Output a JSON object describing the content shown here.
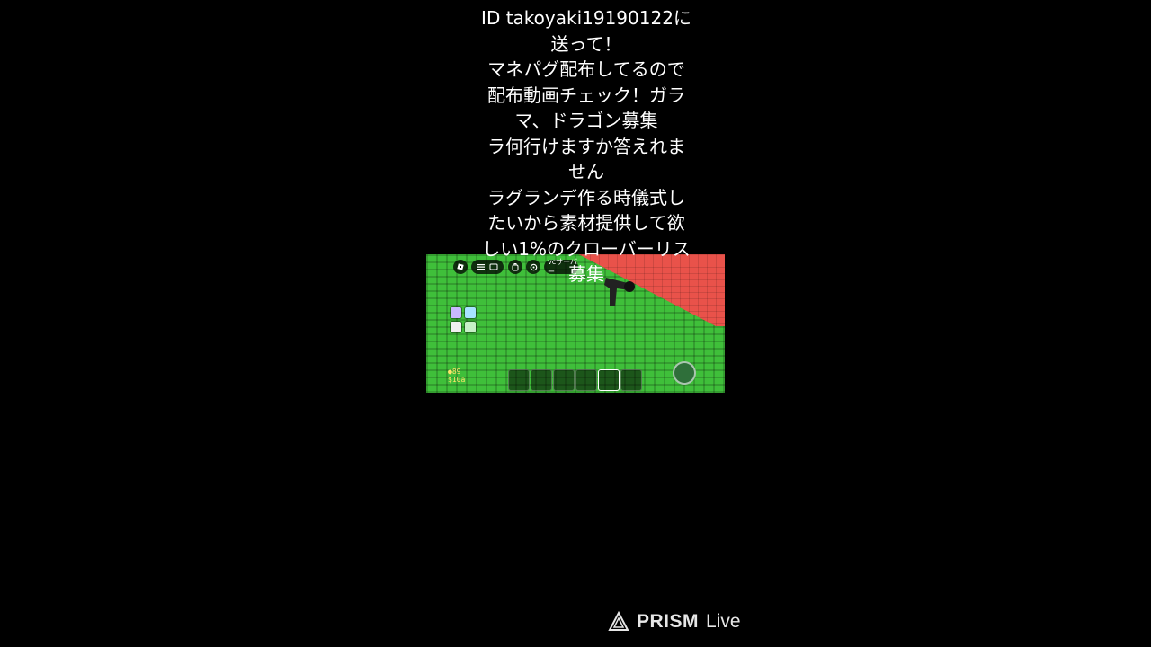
{
  "caption": {
    "lines": [
      "ID takoyaki19190122に",
      "送って！",
      "マネパグ配布してるので",
      "配布動画チェック！ガラ",
      "マ、ドラゴン募集",
      "ラ何行けますか答えれま",
      "せん",
      "ラグランデ作る時儀式し",
      "たいから素材提供して欲",
      "しい1%のクローバーリス",
      "募集"
    ]
  },
  "game": {
    "top_bar": {
      "vc_label": "vcサーバー"
    },
    "hud": {
      "line1": "●89",
      "line2": "$10a"
    },
    "colors": {
      "grass": "#3fbf3a",
      "red_zone": "#e9524a"
    }
  },
  "watermark": {
    "brand": "PRISM",
    "suffix": "Live"
  }
}
